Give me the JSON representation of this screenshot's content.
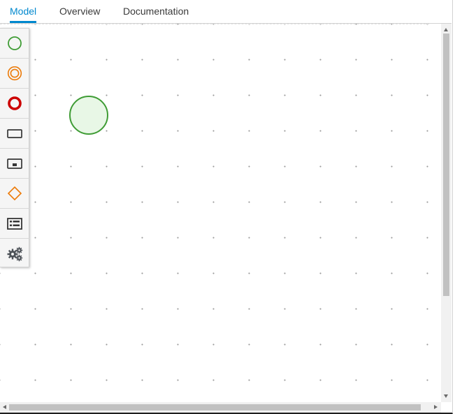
{
  "tabs": [
    {
      "label": "Model",
      "active": true
    },
    {
      "label": "Overview",
      "active": false
    },
    {
      "label": "Documentation",
      "active": false
    }
  ],
  "palette": {
    "items": [
      {
        "icon": "start-event-icon",
        "color": "#3f9c35"
      },
      {
        "icon": "intermediate-event-icon",
        "color": "#ec7a08"
      },
      {
        "icon": "end-event-icon",
        "color": "#cc0000"
      },
      {
        "icon": "task-icon",
        "color": "#363636"
      },
      {
        "icon": "subprocess-icon",
        "color": "#363636"
      },
      {
        "icon": "gateway-icon",
        "color": "#ec7a08"
      },
      {
        "icon": "lane-icon",
        "color": "#363636"
      },
      {
        "icon": "custom-tasks-gear-icon",
        "color": "#4d5258"
      }
    ]
  },
  "canvas": {
    "nodes": [
      {
        "type": "start-event",
        "stroke": "#3f9c35",
        "fill": "#e8f7e6"
      }
    ]
  },
  "colors": {
    "accent": "#0088ce",
    "tab_text": "#3a3a3a"
  }
}
